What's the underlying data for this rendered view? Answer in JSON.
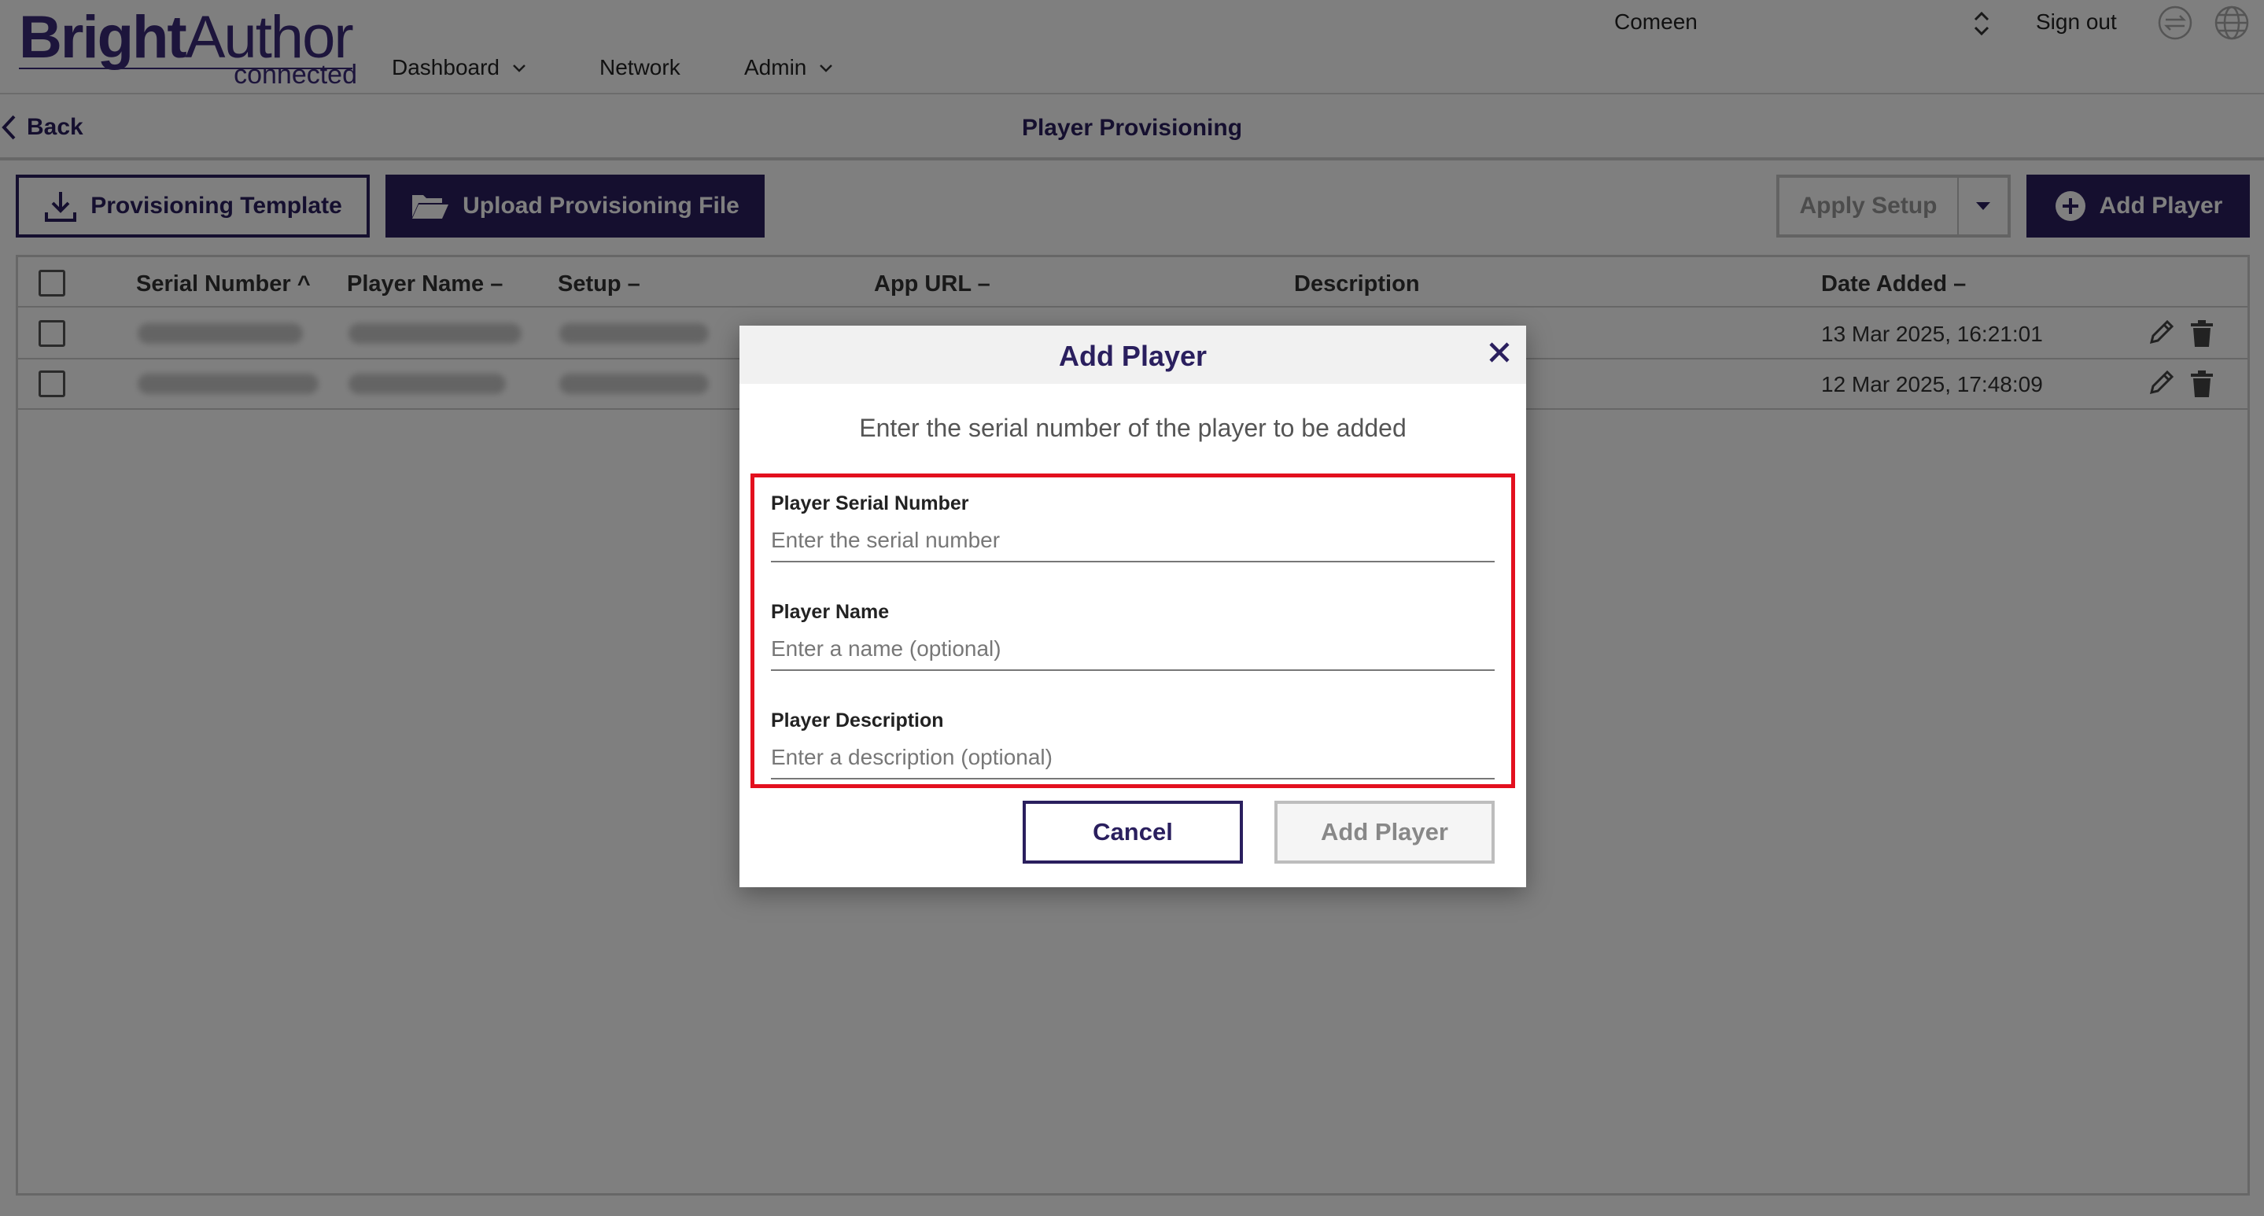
{
  "brand": {
    "name_bold": "Bright",
    "name_light": "Author",
    "sub": "connected",
    "color": "#3b2a78"
  },
  "nav": [
    {
      "label": "Dashboard",
      "has_dropdown": true
    },
    {
      "label": "Network",
      "has_dropdown": false
    },
    {
      "label": "Admin",
      "has_dropdown": true
    }
  ],
  "account": {
    "name": "Comeen",
    "sign_out": "Sign out"
  },
  "subheader": {
    "back_label": "Back",
    "title": "Player Provisioning"
  },
  "toolbar": {
    "provisioning_template": "Provisioning Template",
    "upload_file": "Upload Provisioning File",
    "apply_setup": "Apply Setup",
    "add_player": "Add Player"
  },
  "table": {
    "columns": [
      "Serial Number",
      "Player Name",
      "Setup",
      "App URL",
      "Description",
      "Date Added"
    ],
    "sort_indicators": {
      "Serial Number": "^",
      "Player Name": "–",
      "Setup": "–",
      "App URL": "–",
      "Date Added": "–"
    },
    "rows": [
      {
        "date_added": "13 Mar 2025, 16:21:01"
      },
      {
        "date_added": "12 Mar 2025, 17:48:09"
      }
    ]
  },
  "modal": {
    "title": "Add Player",
    "description": "Enter the serial number of the player to be added",
    "fields": [
      {
        "label": "Player Serial Number",
        "placeholder": "Enter the serial number",
        "value": ""
      },
      {
        "label": "Player Name",
        "placeholder": "Enter a name (optional)",
        "value": ""
      },
      {
        "label": "Player Description",
        "placeholder": "Enter a description (optional)",
        "value": ""
      }
    ],
    "cancel_label": "Cancel",
    "submit_label": "Add Player"
  },
  "colors": {
    "primary": "#2a1f5e",
    "highlight": "#e3101e",
    "overlay": "rgba(0,0,0,0.5)"
  }
}
